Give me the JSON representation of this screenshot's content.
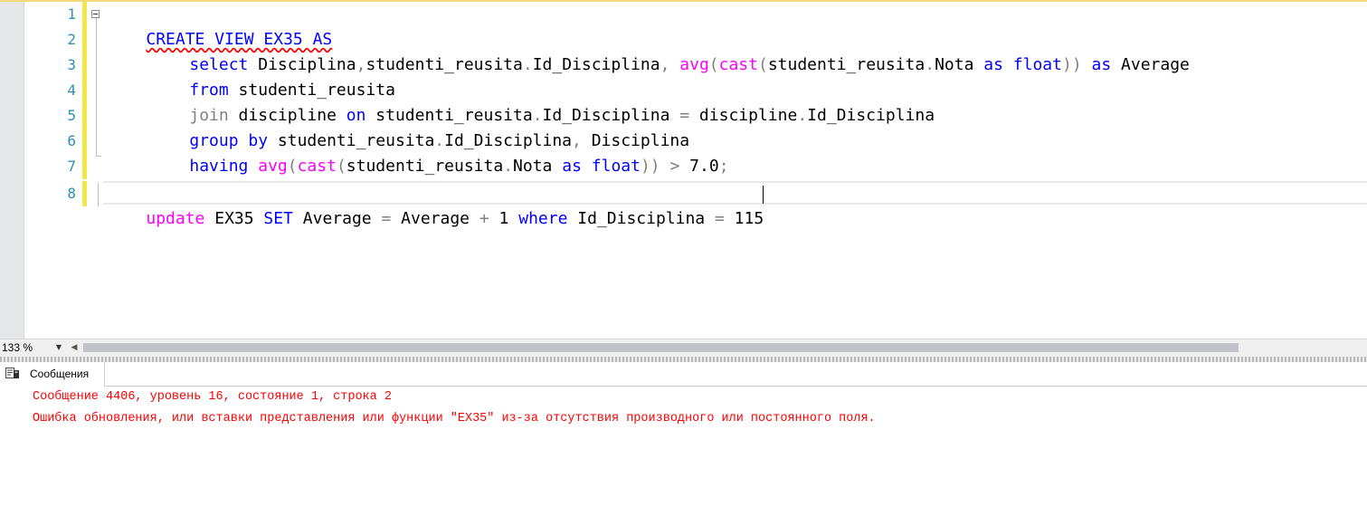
{
  "editor": {
    "line_numbers": [
      "1",
      "2",
      "3",
      "4",
      "5",
      "6",
      "7",
      "8"
    ],
    "lines": [
      [
        "CREATE VIEW EX35 AS"
      ],
      [
        "select",
        " Disciplina",
        ",",
        "studenti_reusita",
        ".",
        "Id_Disciplina",
        ",",
        " ",
        "avg",
        "(",
        "cast",
        "(",
        "studenti_reusita",
        ".",
        "Nota",
        " ",
        "as",
        " ",
        "float",
        "))",
        " ",
        "as",
        " Average"
      ],
      [
        "from",
        " studenti_reusita"
      ],
      [
        "join",
        " discipline ",
        "on",
        " studenti_reusita",
        ".",
        "Id_Disciplina ",
        "=",
        " discipline",
        ".",
        "Id_Disciplina"
      ],
      [
        "group by",
        " studenti_reusita",
        ".",
        "Id_Disciplina",
        ",",
        " Disciplina"
      ],
      [
        "having",
        " ",
        "avg",
        "(",
        "cast",
        "(",
        "studenti_reusita",
        ".",
        "Nota",
        " ",
        "as",
        " ",
        "float",
        "))",
        " ",
        ">",
        " 7.0",
        ";"
      ],
      [],
      [
        "update",
        " EX35 ",
        "SET",
        " Average ",
        "=",
        " Average ",
        "+",
        " 1 ",
        "where",
        " Id_Disciplina ",
        "=",
        " 115"
      ]
    ]
  },
  "zoom": {
    "value": "133 %"
  },
  "messages": {
    "tab_label": "Сообщения",
    "lines": [
      "Сообщение 4406, уровень 16, состояние 1, строка 2",
      "Ошибка обновления, или вставки представления или функции \"EX35\" из-за отсутствия производного или постоянного поля."
    ]
  },
  "colors": {
    "keyword": "#0000ff",
    "function": "#ff00ff",
    "operator": "#808080",
    "line_number": "#2b91af",
    "change_bar": "#f1e84a",
    "error_text": "#ff0000"
  }
}
